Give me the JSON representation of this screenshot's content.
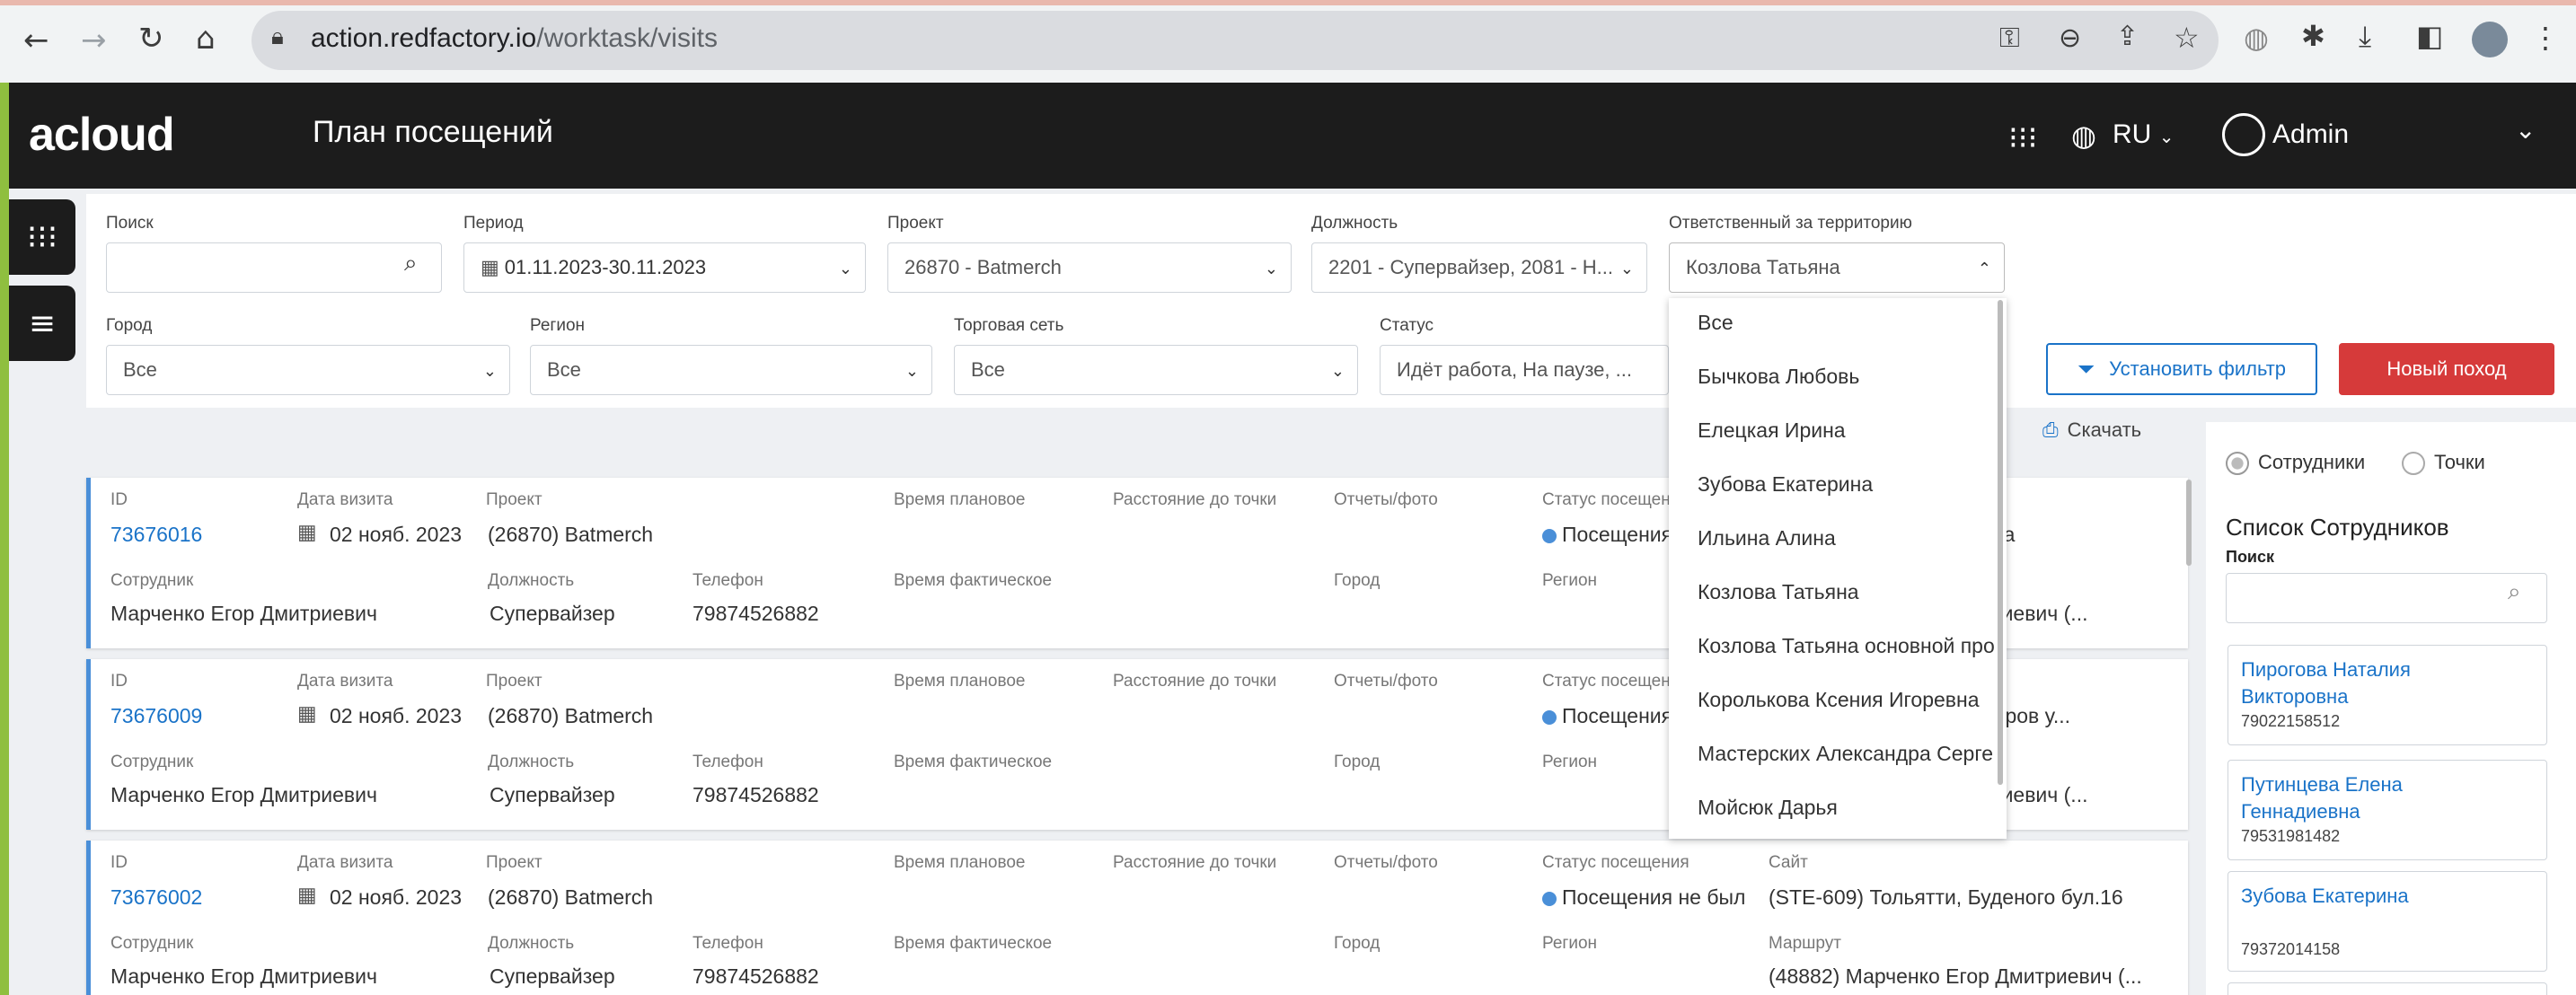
{
  "browser": {
    "url_domain": "action.redfactory.io",
    "url_path": "/worktask/visits",
    "icons": [
      "back-arrow-icon",
      "forward-arrow-icon",
      "reload-icon",
      "home-icon",
      "lock-icon",
      "key-icon",
      "zoom-icon",
      "share-icon",
      "star-icon",
      "globe-icon",
      "puzzle-icon",
      "download-icon",
      "sidebar-icon",
      "avatar-icon"
    ]
  },
  "app": {
    "logo": "acloud",
    "title": "План посещений",
    "lang": "RU",
    "user": "Admin"
  },
  "filters": {
    "search_label": "Поиск",
    "search_value": "",
    "period_label": "Период",
    "period_value": "01.11.2023-30.11.2023",
    "project_label": "Проект",
    "project_value": "26870 - Batmerch",
    "position_label": "Должность",
    "position_value": "2201 - Супервайзер, 2081 - Н...",
    "responsible_label": "Ответственный за территорию",
    "responsible_value": "Козлова Татьяна",
    "city_label": "Город",
    "city_value": "Все",
    "region_label": "Регион",
    "region_value": "Все",
    "chain_label": "Торговая сеть",
    "chain_value": "Все",
    "status_label": "Статус",
    "status_value": "Идёт работа, На паузе, ...",
    "set_filter": "Установить фильтр",
    "new_visit": "Новый поход",
    "download": "Скачать"
  },
  "dropdown": {
    "items": [
      "Все",
      "Бычкова Любовь",
      "Елецкая Ирина",
      "Зубова Екатерина",
      "Ильина Алина",
      "Козлова Татьяна",
      "Козлова Татьяна основной про",
      "Королькова Ксения Игоревна",
      "Мастерских Александра Серге",
      "Мойсюк Дарья"
    ]
  },
  "card_labels": {
    "id": "ID",
    "date": "Дата визита",
    "project": "Проект",
    "time_plan": "Время плановое",
    "distance": "Расстояние до точки",
    "reports": "Отчеты/фото",
    "status": "Статус посещения",
    "site": "Сайт",
    "employee": "Сотрудник",
    "position": "Должность",
    "phone": "Телефон",
    "time_fact": "Время фактическое",
    "city": "Город",
    "region": "Регион",
    "route": "Маршрут"
  },
  "visits": [
    {
      "id": "73676016",
      "date": "02 нояб. 2023",
      "project": "(26870) Batmerch",
      "status": "Посещения",
      "site": "цева 1а",
      "employee": "Марченко Егор Дмитриевич",
      "position": "Супервайзер",
      "phone": "79874526882",
      "route": "Дмитриевич (..."
    },
    {
      "id": "73676009",
      "date": "02 нояб. 2023",
      "project": "(26870) Batmerch",
      "status": "Посещения",
      "site": "низаторов у...",
      "employee": "Марченко Егор Дмитриевич",
      "position": "Супервайзер",
      "phone": "79874526882",
      "route": "Дмитриевич (..."
    },
    {
      "id": "73676002",
      "date": "02 нояб. 2023",
      "project": "(26870) Batmerch",
      "status": "Посещения не был",
      "site": "(STE-609) Тольятти, Буденого бул.16",
      "employee": "Марченко Егор Дмитриевич",
      "position": "Супервайзер",
      "phone": "79874526882",
      "route": "(48882) Марченко Егор Дмитриевич (..."
    }
  ],
  "right_panel": {
    "radio_employees": "Сотрудники",
    "radio_points": "Точки",
    "title": "Список Сотрудников",
    "search_label": "Поиск",
    "employees": [
      {
        "name_line1": "Пирогова Наталия",
        "name_line2": "Викторовна",
        "phone": "79022158512"
      },
      {
        "name_line1": "Путинцева Елена",
        "name_line2": "Геннадиевна",
        "phone": "79531981482"
      },
      {
        "name_line1": "Зубова Екатерина",
        "name_line2": "",
        "phone": "79372014158"
      }
    ]
  }
}
